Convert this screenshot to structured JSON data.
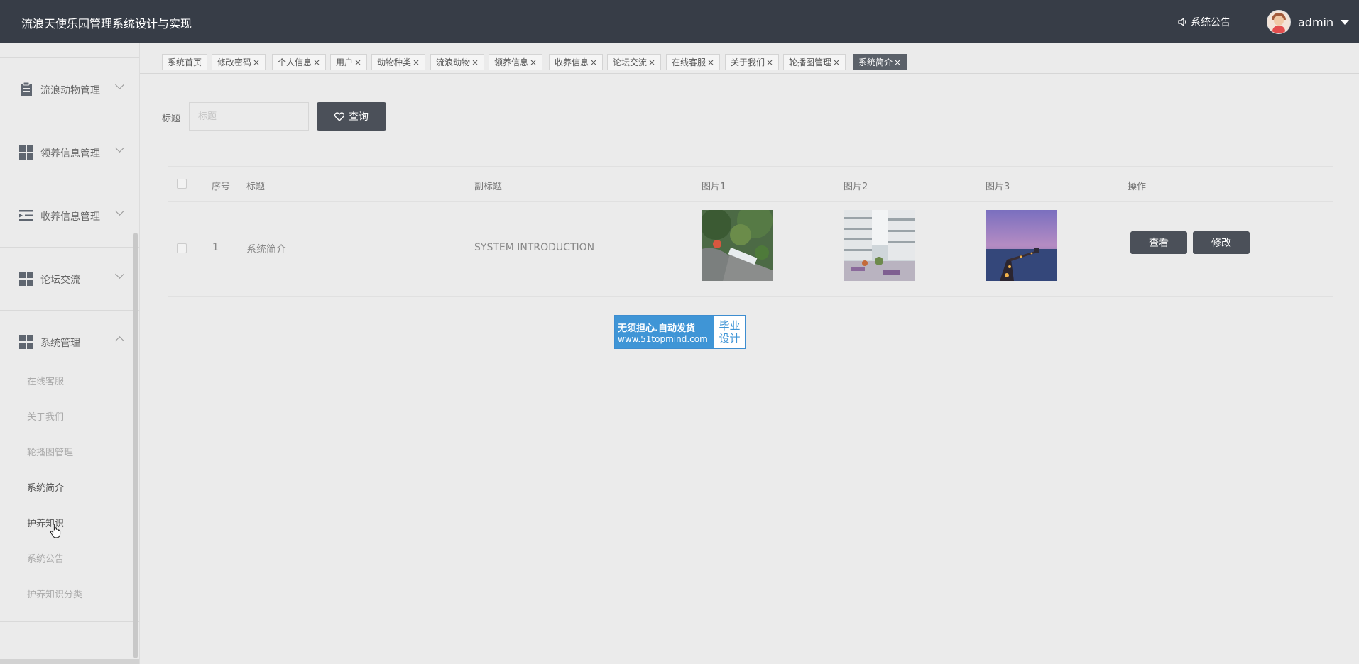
{
  "header": {
    "title": "流浪天使乐园管理系统设计与实现",
    "notice_label": "系统公告",
    "user_name": "admin"
  },
  "sidebar": {
    "groups": [
      {
        "label": "流浪动物管理",
        "icon": "clipboard-icon",
        "expanded": false
      },
      {
        "label": "领养信息管理",
        "icon": "grid-icon",
        "expanded": false
      },
      {
        "label": "收养信息管理",
        "icon": "list-indent-icon",
        "expanded": false
      },
      {
        "label": "论坛交流",
        "icon": "grid-icon",
        "expanded": false
      },
      {
        "label": "系统管理",
        "icon": "grid-icon",
        "expanded": true
      }
    ],
    "sub_items": [
      "在线客服",
      "关于我们",
      "轮播图管理",
      "系统简介",
      "护养知识",
      "系统公告",
      "护养知识分类"
    ],
    "active_sub": "系统简介"
  },
  "tabs": [
    "系统首页",
    "修改密码",
    "个人信息",
    "用户",
    "动物种类",
    "流浪动物",
    "领养信息",
    "收养信息",
    "论坛交流",
    "在线客服",
    "关于我们",
    "轮播图管理",
    "系统简介"
  ],
  "active_tab": "系统简介",
  "tab_close": "×",
  "search": {
    "label": "标题",
    "placeholder": "标题",
    "value": "",
    "button_label": "查询"
  },
  "table": {
    "columns": [
      "序号",
      "标题",
      "副标题",
      "图片1",
      "图片2",
      "图片3",
      "操作"
    ],
    "rows": [
      {
        "index": "1",
        "title": "系统简介",
        "subtitle": "SYSTEM INTRODUCTION",
        "view_label": "查看",
        "edit_label": "修改"
      }
    ]
  },
  "watermark": {
    "line1": "无须担心.自动发货",
    "line2": "www.51topmind.com",
    "right1": "毕业",
    "right2": "设计"
  },
  "colors": {
    "header_bg": "#373d47",
    "button_bg": "#4b5059",
    "active_tab_bg": "#5b6169",
    "watermark_blue": "#3f95d6"
  }
}
